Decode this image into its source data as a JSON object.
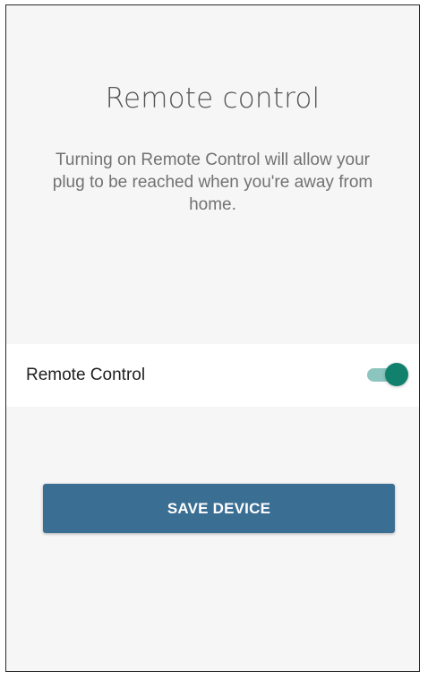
{
  "screen": {
    "title": "Remote control",
    "description": "Turning on Remote Control will allow your plug to be reached when you're away from home."
  },
  "setting": {
    "label": "Remote Control",
    "enabled": true
  },
  "actions": {
    "save_label": "SAVE DEVICE"
  },
  "colors": {
    "background": "#f6f6f6",
    "toggle_thumb": "#11816d",
    "toggle_track": "#8cc5bf",
    "button": "#3a6e93"
  }
}
